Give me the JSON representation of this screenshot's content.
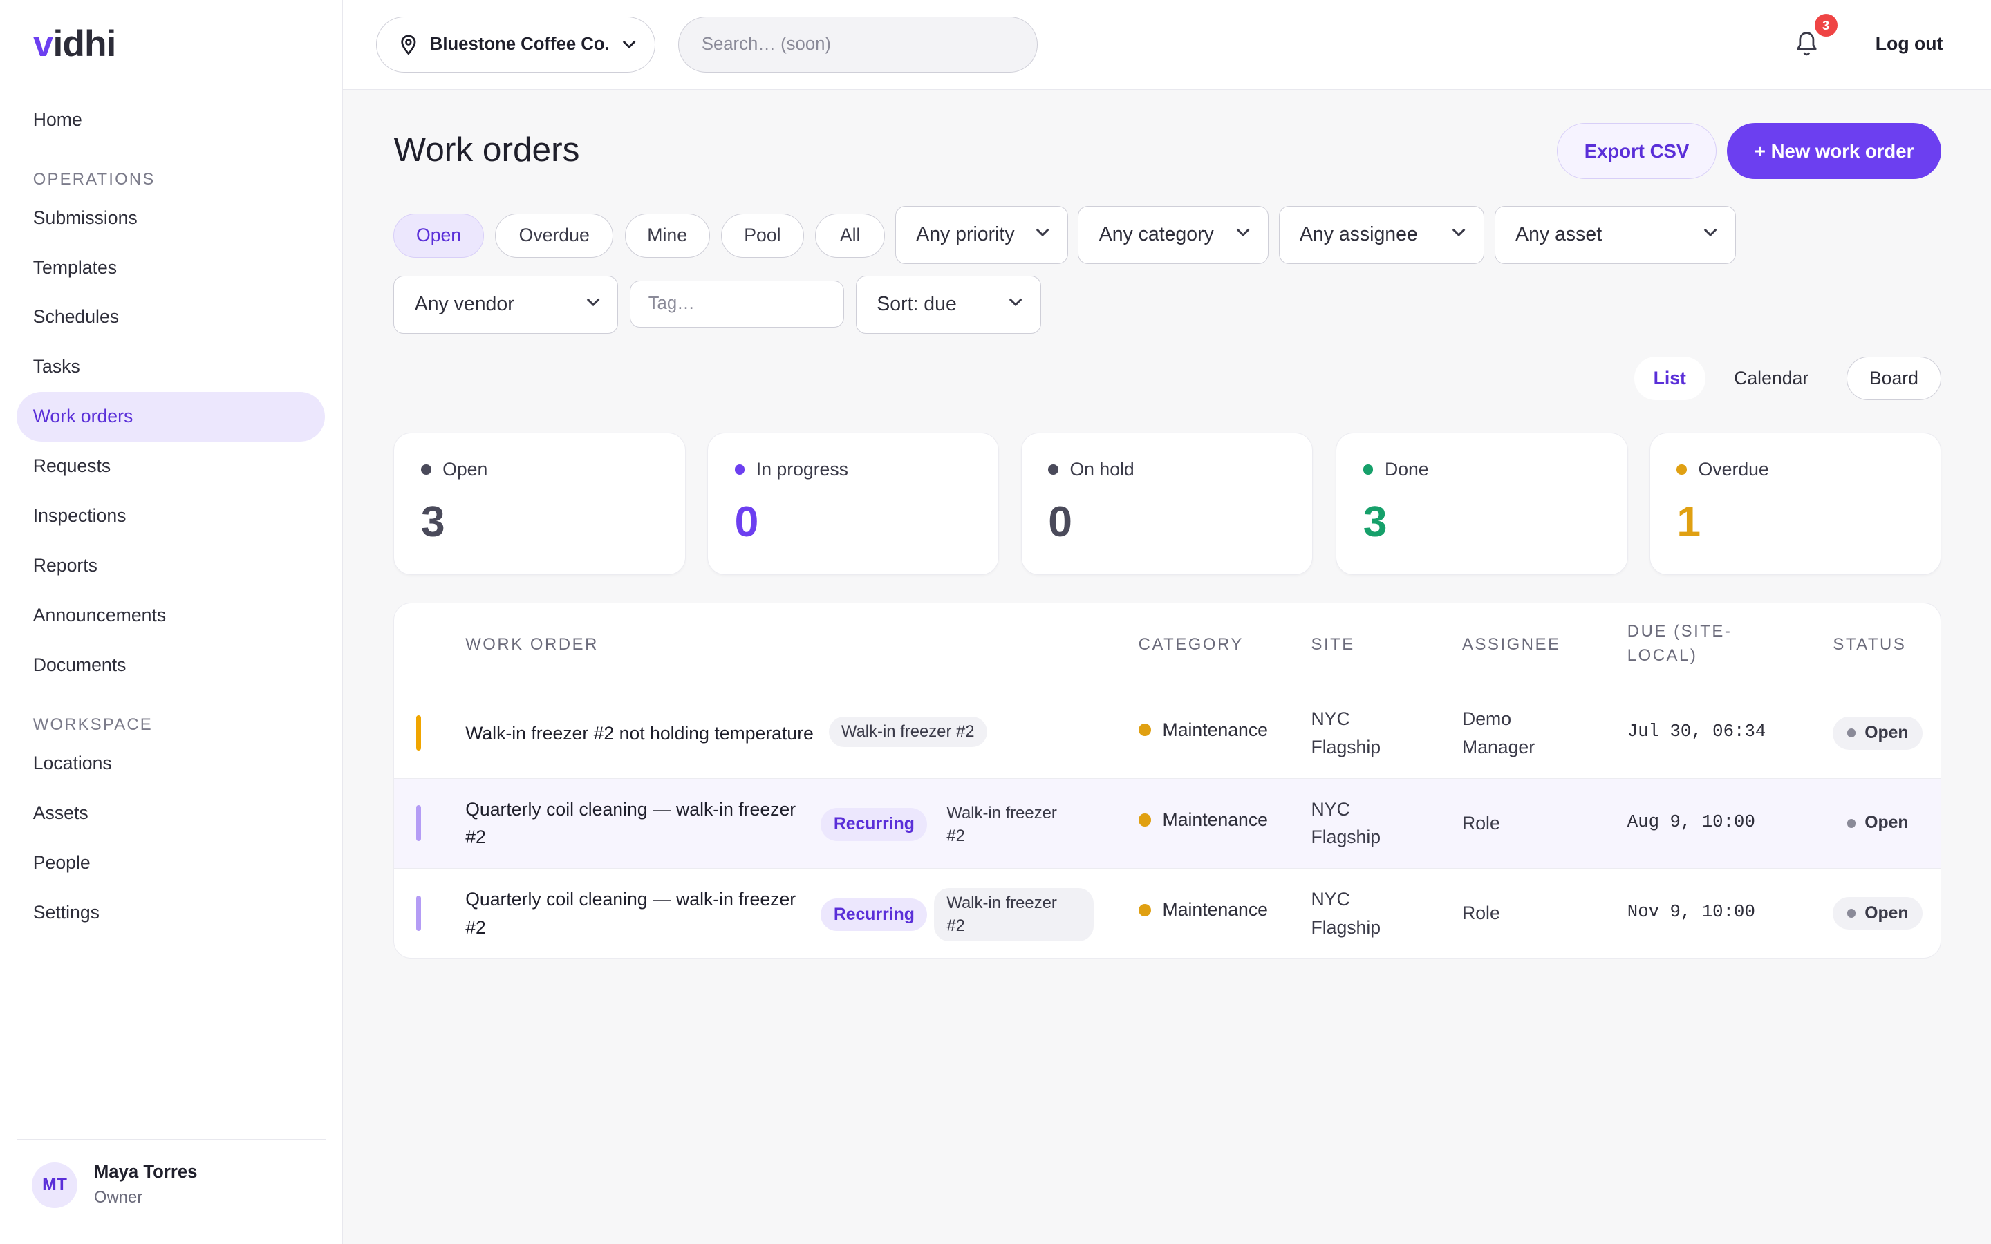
{
  "app": {
    "logo": "vidhi",
    "logo_accent": "v",
    "logo_rest": "idhi"
  },
  "sidebar": {
    "items_top": [
      {
        "label": "Home"
      }
    ],
    "section_ops": "OPERATIONS",
    "items_ops": [
      {
        "label": "Submissions"
      },
      {
        "label": "Templates"
      },
      {
        "label": "Schedules"
      },
      {
        "label": "Tasks"
      },
      {
        "label": "Work orders"
      },
      {
        "label": "Requests"
      },
      {
        "label": "Inspections"
      },
      {
        "label": "Reports"
      },
      {
        "label": "Announcements"
      },
      {
        "label": "Documents"
      }
    ],
    "section_ws": "WORKSPACE",
    "items_ws": [
      {
        "label": "Locations"
      },
      {
        "label": "Assets"
      },
      {
        "label": "People"
      },
      {
        "label": "Settings"
      }
    ],
    "active": "Work orders"
  },
  "user": {
    "initials": "MT",
    "name": "Maya Torres",
    "role": "Owner"
  },
  "topbar": {
    "org": "Bluestone Coffee Co.",
    "search_placeholder": "Search… (soon)",
    "notifications": "3",
    "logout": "Log out"
  },
  "page": {
    "title": "Work orders",
    "export_label": "Export CSV",
    "new_label": "+ New work order"
  },
  "filters": {
    "chips": [
      "Open",
      "Overdue",
      "Mine",
      "Pool",
      "All"
    ],
    "active_chip": "Open",
    "priority": "Any priority",
    "category": "Any category",
    "assignee": "Any assignee",
    "asset": "Any asset",
    "vendor": "Any vendor",
    "tag_placeholder": "Tag…",
    "sort": "Sort: due"
  },
  "views": {
    "list": "List",
    "calendar": "Calendar",
    "board": "Board",
    "active": "List"
  },
  "stats": [
    {
      "label": "Open",
      "value": "3",
      "color": "#4a4a5a"
    },
    {
      "label": "In progress",
      "value": "0",
      "color": "#6c3ff0"
    },
    {
      "label": "On hold",
      "value": "0",
      "color": "#4a4a5a"
    },
    {
      "label": "Done",
      "value": "3",
      "color": "#16a06a"
    },
    {
      "label": "Overdue",
      "value": "1",
      "color": "#e0a012"
    }
  ],
  "table": {
    "headers": {
      "work_order": "WORK ORDER",
      "category": "CATEGORY",
      "site": "SITE",
      "assignee": "ASSIGNEE",
      "due": "DUE (SITE-LOCAL)",
      "due_line1": "DUE (SITE-",
      "due_line2": "LOCAL)",
      "status": "STATUS"
    },
    "rows": [
      {
        "title": "Walk-in freezer #2 not holding temperature",
        "tag": "Walk-in freezer #2",
        "recurring": "",
        "category": "Maintenance",
        "site_line1": "NYC",
        "site_line2": "Flagship",
        "assignee_line1": "Demo",
        "assignee_line2": "Manager",
        "due": "Jul 30, 06:34",
        "status": "Open",
        "priority_color": "#f0a500"
      },
      {
        "title_line1": "Quarterly coil cleaning — walk-in freezer",
        "title_line2": "#2",
        "recurring": "Recurring",
        "tag_line1": "Walk-in freezer",
        "tag_line2": "#2",
        "category": "Maintenance",
        "site_line1": "NYC",
        "site_line2": "Flagship",
        "assignee": "Role",
        "due": "Aug 9, 10:00",
        "status": "Open",
        "priority_color": "#b49cf5"
      },
      {
        "title_line1": "Quarterly coil cleaning — walk-in freezer",
        "title_line2": "#2",
        "recurring": "Recurring",
        "tag_line1": "Walk-in freezer",
        "tag_line2": "#2",
        "category": "Maintenance",
        "site_line1": "NYC",
        "site_line2": "Flagship",
        "assignee": "Role",
        "due": "Nov 9, 10:00",
        "status": "Open",
        "priority_color": "#b49cf5"
      }
    ],
    "category_color": "#e0a012"
  },
  "colors": {
    "accent": "#6c3ff0",
    "accent_soft": "#ece7fd",
    "danger": "#ef4444"
  }
}
